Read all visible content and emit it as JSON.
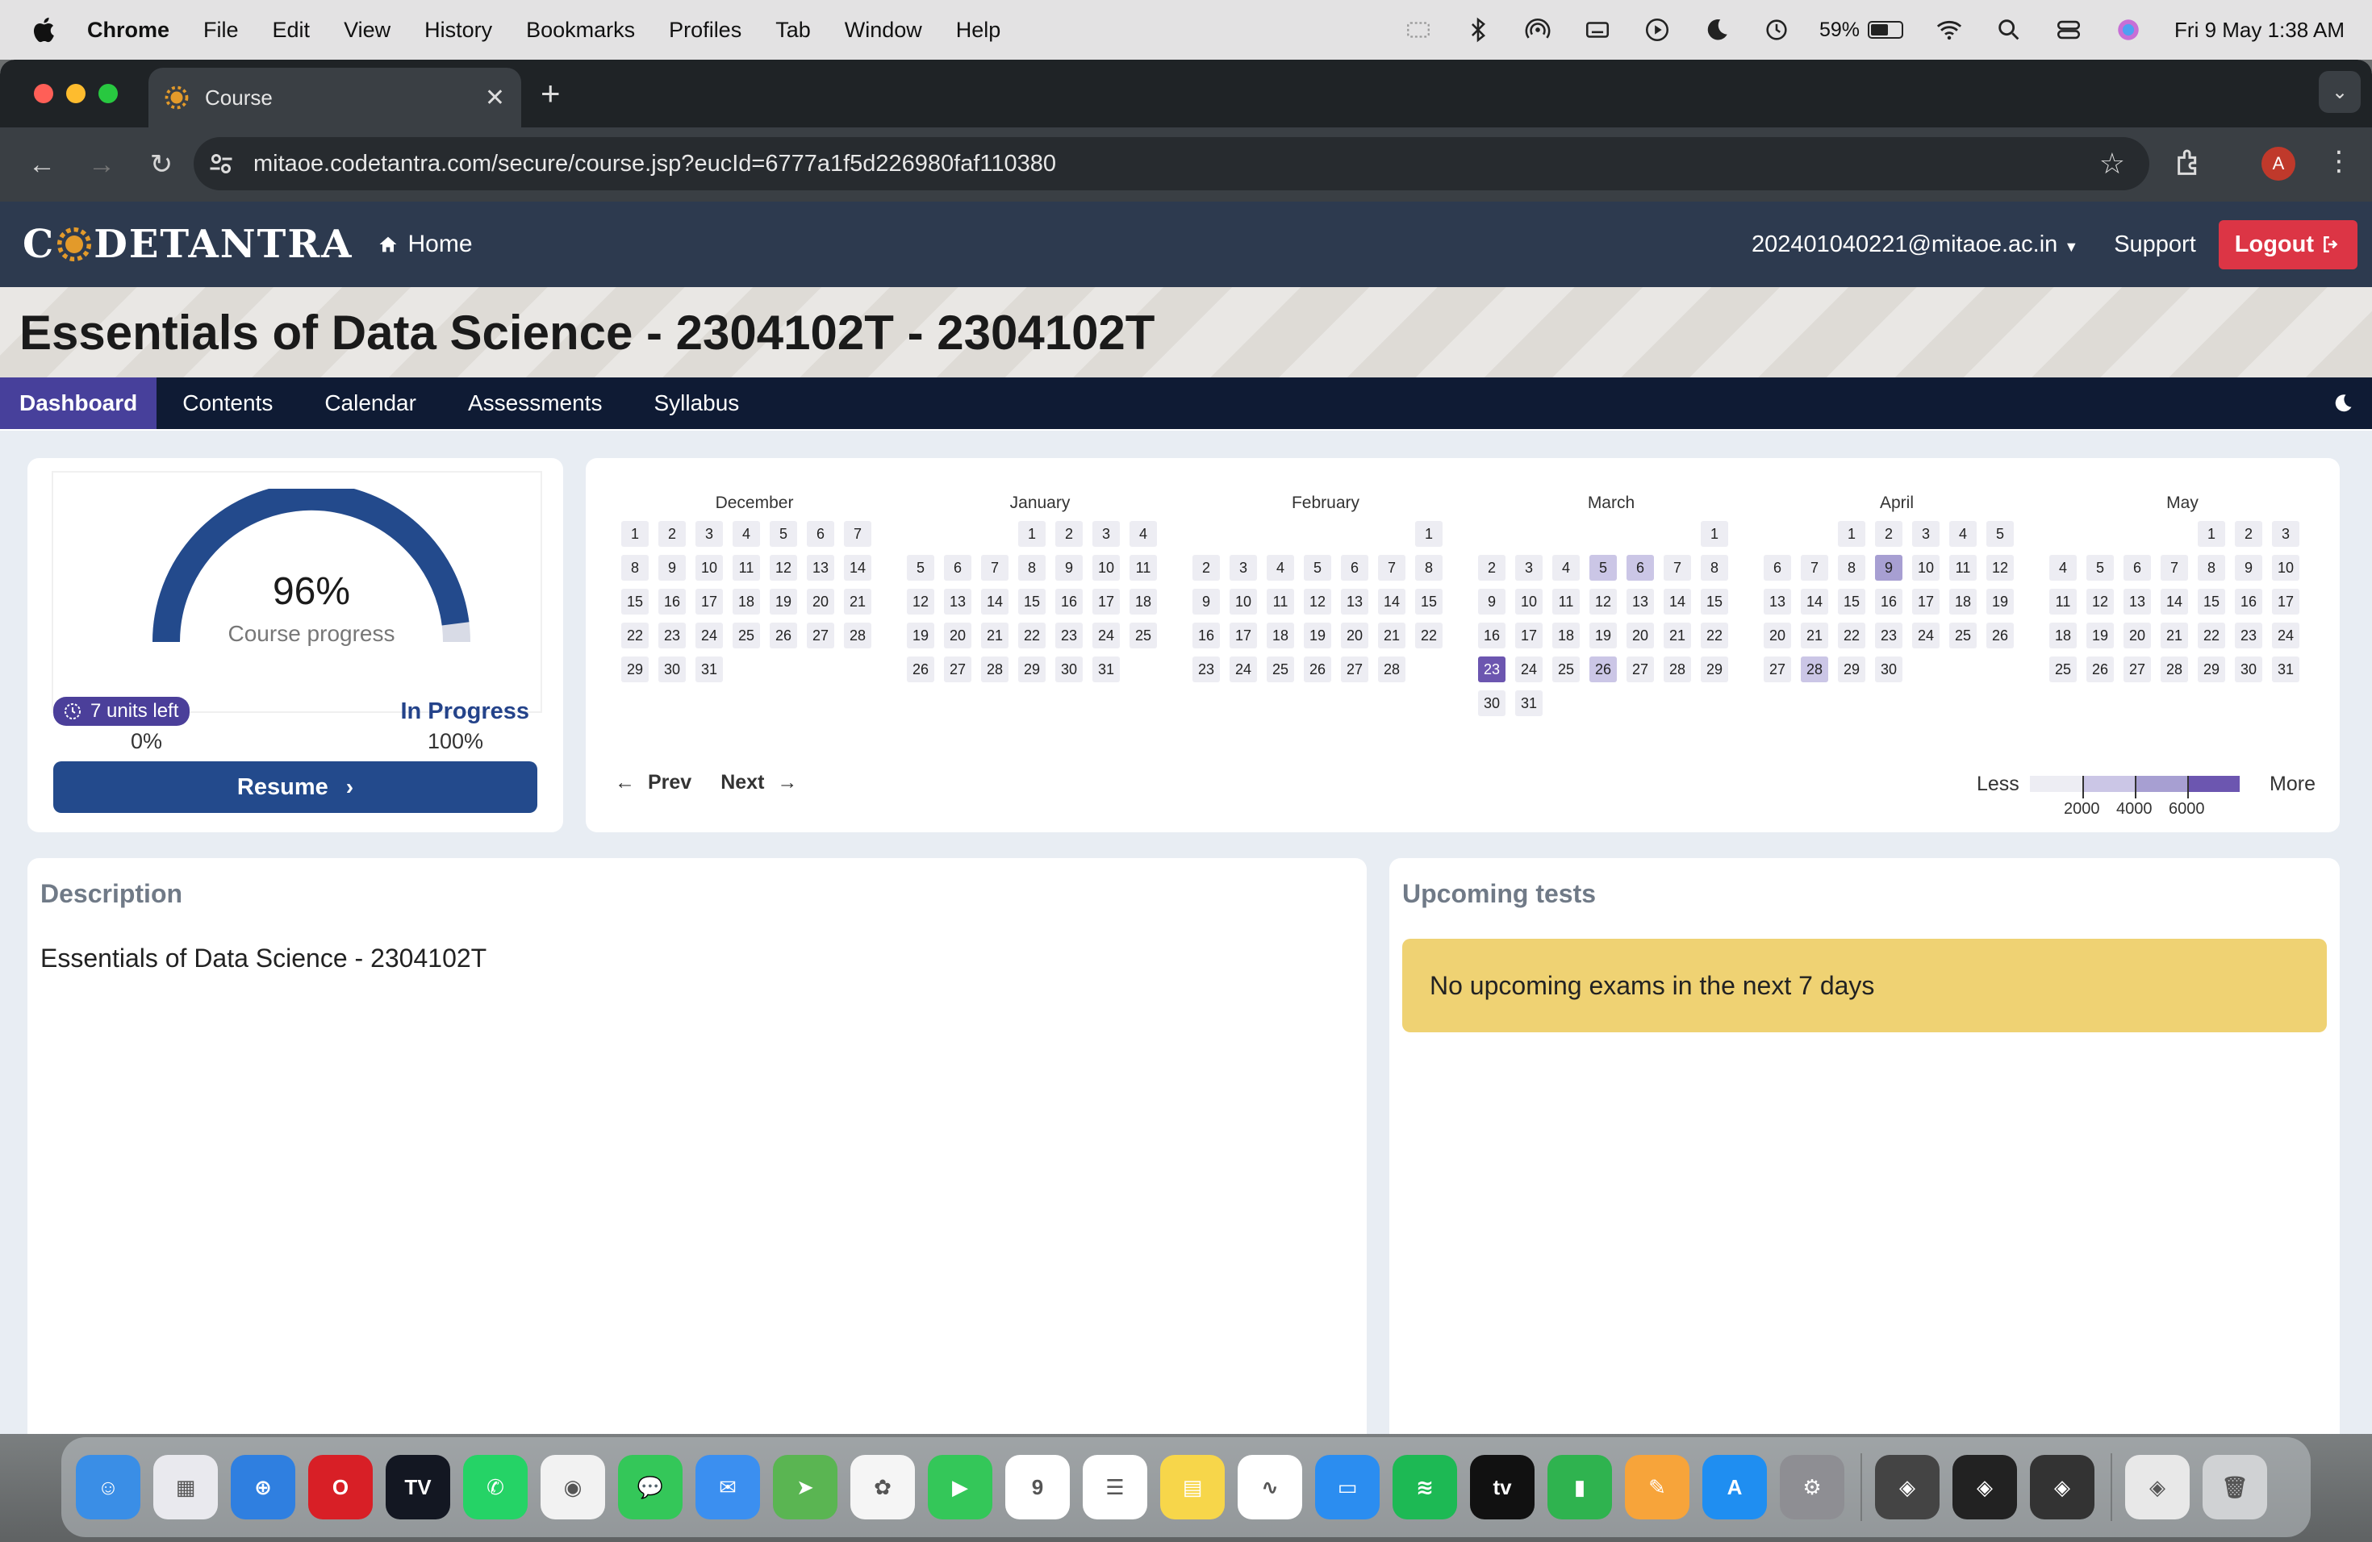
{
  "menubar": {
    "app_name": "Chrome",
    "items": [
      "File",
      "Edit",
      "View",
      "History",
      "Bookmarks",
      "Profiles",
      "Tab",
      "Window",
      "Help"
    ],
    "battery_percent": "59%",
    "battery_level": 0.59,
    "datetime": "Fri 9 May  1:38 AM"
  },
  "browser": {
    "tab_title": "Course",
    "url": "mitaoe.codetantra.com/secure/course.jsp?eucId=6777a1f5d226980faf110380",
    "profile_initial": "A"
  },
  "site": {
    "logo_text_left": "C",
    "logo_text_right": "DETANTRA",
    "home_label": "Home",
    "user_email": "202401040221@mitaoe.ac.in",
    "support_label": "Support",
    "logout_label": "Logout"
  },
  "course": {
    "title": "Essentials of Data Science - 2304102T - 2304102T"
  },
  "subnav": {
    "tabs": [
      "Dashboard",
      "Contents",
      "Calendar",
      "Assessments",
      "Syllabus"
    ],
    "active": "Dashboard"
  },
  "progress": {
    "percent_label": "96%",
    "percent_value": 96,
    "label": "Course progress",
    "min_label": "0%",
    "max_label": "100%",
    "units_left": "7 units left",
    "status": "In Progress",
    "resume_label": "Resume"
  },
  "heatmap": {
    "months": [
      {
        "name": "December",
        "offset": 0,
        "days": 31,
        "levels": {}
      },
      {
        "name": "January",
        "offset": 3,
        "days": 31,
        "levels": {}
      },
      {
        "name": "February",
        "offset": 6,
        "days": 28,
        "levels": {}
      },
      {
        "name": "March",
        "offset": 6,
        "days": 31,
        "levels": {
          "5": 1,
          "6": 1,
          "23": 3,
          "26": 1
        }
      },
      {
        "name": "April",
        "offset": 2,
        "days": 30,
        "levels": {
          "9": 2,
          "28": 1
        }
      },
      {
        "name": "May",
        "offset": 4,
        "days": 31,
        "levels": {}
      }
    ],
    "prev_label": "Prev",
    "next_label": "Next",
    "legend_less": "Less",
    "legend_more": "More",
    "legend_ticks": [
      "2000",
      "4000",
      "6000"
    ],
    "colors": [
      "#ededf3",
      "#cbc6e6",
      "#a79fd2",
      "#6c56b0"
    ]
  },
  "description": {
    "title": "Description",
    "text": "Essentials of Data Science - 2304102T"
  },
  "tests": {
    "title": "Upcoming tests",
    "message": "No upcoming exams in the next 7 days"
  },
  "dock": {
    "apps": [
      {
        "name": "finder",
        "color": "#3a8ee6",
        "glyph": "☺"
      },
      {
        "name": "launchpad",
        "color": "#e9e9ee",
        "glyph": "▦"
      },
      {
        "name": "safari",
        "color": "#2f7fe0",
        "glyph": "⊕"
      },
      {
        "name": "opera",
        "color": "#d81f26",
        "glyph": "O"
      },
      {
        "name": "tradingview",
        "color": "#131722",
        "glyph": "TV"
      },
      {
        "name": "whatsapp",
        "color": "#25d366",
        "glyph": "✆"
      },
      {
        "name": "chrome",
        "color": "#f2f2f2",
        "glyph": "◉"
      },
      {
        "name": "messages",
        "color": "#34c759",
        "glyph": "💬"
      },
      {
        "name": "mail",
        "color": "#3b8ff0",
        "glyph": "✉"
      },
      {
        "name": "maps",
        "color": "#5ab552",
        "glyph": "➤"
      },
      {
        "name": "photos",
        "color": "#f5f5f5",
        "glyph": "✿"
      },
      {
        "name": "facetime",
        "color": "#34c759",
        "glyph": "▶"
      },
      {
        "name": "calendar",
        "color": "#ffffff",
        "glyph": "9"
      },
      {
        "name": "reminders",
        "color": "#ffffff",
        "glyph": "☰"
      },
      {
        "name": "notes",
        "color": "#f7d64a",
        "glyph": "▤"
      },
      {
        "name": "freeform",
        "color": "#ffffff",
        "glyph": "∿"
      },
      {
        "name": "keynote",
        "color": "#2b8df0",
        "glyph": "▭"
      },
      {
        "name": "spotify",
        "color": "#1db954",
        "glyph": "≋"
      },
      {
        "name": "tv",
        "color": "#111111",
        "glyph": "tv"
      },
      {
        "name": "numbers",
        "color": "#2fb34f",
        "glyph": "▮"
      },
      {
        "name": "pages",
        "color": "#f7a43a",
        "glyph": "✎"
      },
      {
        "name": "app-store",
        "color": "#1f8ef1",
        "glyph": "A"
      },
      {
        "name": "system-settings",
        "color": "#8e8e93",
        "glyph": "⚙"
      },
      {
        "name": "unity-hub",
        "color": "#444",
        "glyph": "◈"
      },
      {
        "name": "unity-1",
        "color": "#222",
        "glyph": "◈"
      },
      {
        "name": "unity-2",
        "color": "#333",
        "glyph": "◈"
      },
      {
        "name": "downloads",
        "color": "#e8e8e8",
        "glyph": "◈"
      },
      {
        "name": "trash",
        "color": "#d0d2d4",
        "glyph": "🗑"
      }
    ]
  }
}
